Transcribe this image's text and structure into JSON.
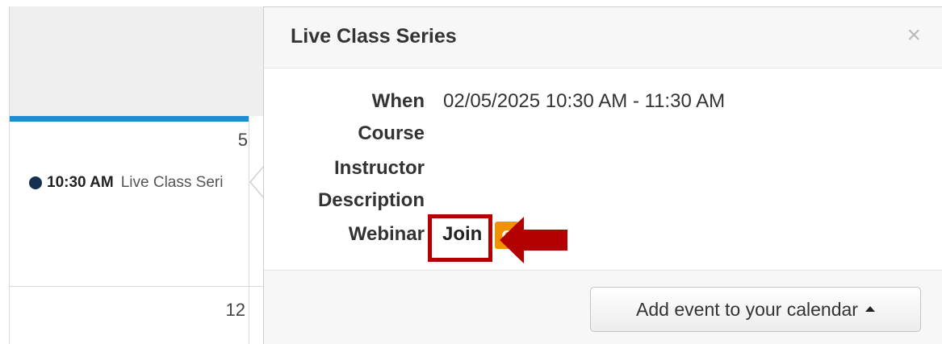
{
  "calendar": {
    "day_5": "5",
    "day_12": "12",
    "event": {
      "time": "10:30 AM",
      "title": "Live Class Series"
    },
    "colors": {
      "today_bar": "#1c8fd0",
      "event_dot": "#16304f"
    }
  },
  "popover": {
    "title": "Live Class Series",
    "close_icon": "close-icon",
    "close_glyph": "×",
    "details": {
      "when_label": "When",
      "when_value": "02/05/2025 10:30 AM - 11:30 AM",
      "course_label": "Course",
      "instructor_label": "Instructor",
      "description_label": "Description",
      "webinar_label": "Webinar",
      "join_label": "Join",
      "webinar_logo_icon": "webinar-logo-icon",
      "webinar_logo_glyph": "e"
    },
    "footer": {
      "add_to_calendar_label": "Add event to your calendar",
      "caret_icon": "caret-up-icon"
    }
  },
  "annotation": {
    "highlight_color": "#b30000",
    "arrow_icon": "red-arrow-icon"
  }
}
